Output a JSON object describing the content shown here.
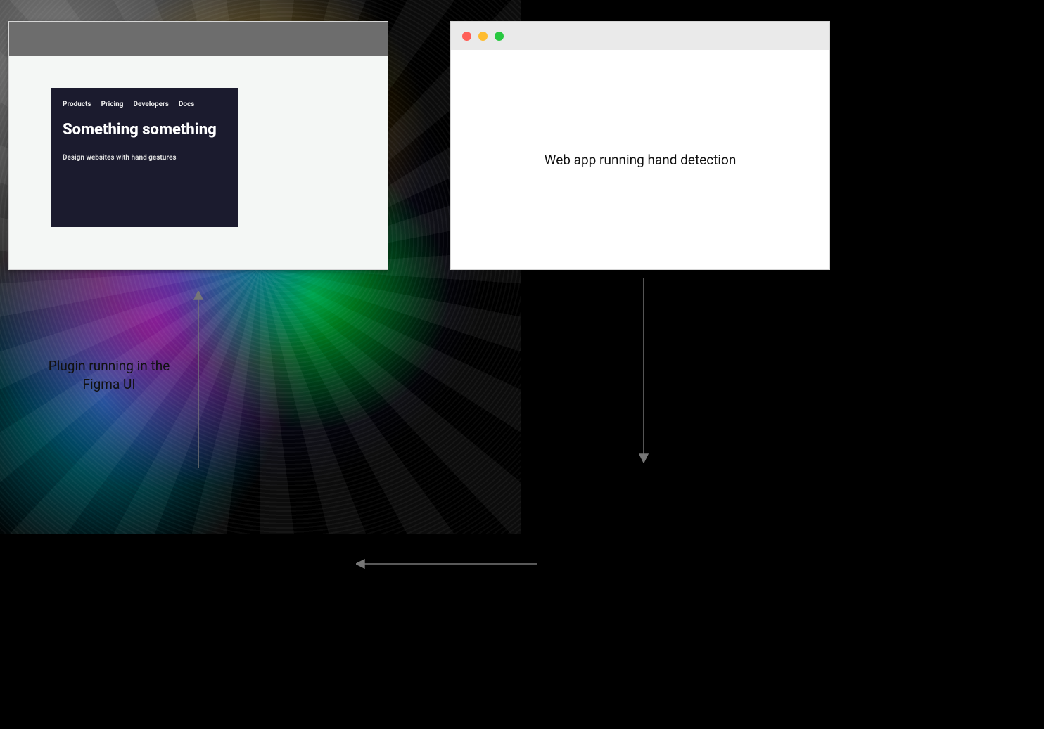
{
  "left_window": {
    "nav": {
      "products": "Products",
      "pricing": "Pricing",
      "developers": "Developers",
      "docs": "Docs"
    },
    "hero_title": "Something something",
    "hero_sub": "Design websites with hand gestures"
  },
  "right_window": {
    "body_text": "Web app running hand detection"
  },
  "labels": {
    "left": "Plugin running in the Figma UI"
  },
  "traffic_light_colors": {
    "red": "#ff5f57",
    "yellow": "#febc2e",
    "green": "#28c840"
  }
}
